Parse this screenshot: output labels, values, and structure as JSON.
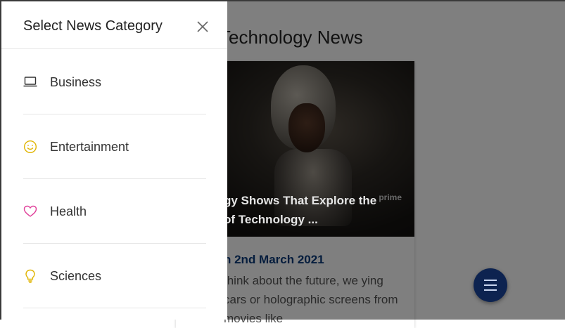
{
  "page": {
    "title": "Technology News",
    "article": {
      "caption_line1": "gy Shows That Explore the",
      "caption_line2": "of Technology ...",
      "brand_mark": "prime",
      "date": "n 2nd March 2021",
      "excerpt": "think about the future, we ying cars or holographic screens from movies like"
    }
  },
  "drawer": {
    "title": "Select News Category",
    "close_icon": "close-icon",
    "items": [
      {
        "label": "Business",
        "icon": "laptop-icon",
        "color": "#333333"
      },
      {
        "label": "Entertainment",
        "icon": "smiley-icon",
        "color": "#e0b400"
      },
      {
        "label": "Health",
        "icon": "heart-icon",
        "color": "#e0409a"
      },
      {
        "label": "Sciences",
        "icon": "lightbulb-icon",
        "color": "#e0b400"
      }
    ]
  },
  "menu_button": {
    "icon": "hamburger-icon",
    "color": "#0d2350"
  }
}
